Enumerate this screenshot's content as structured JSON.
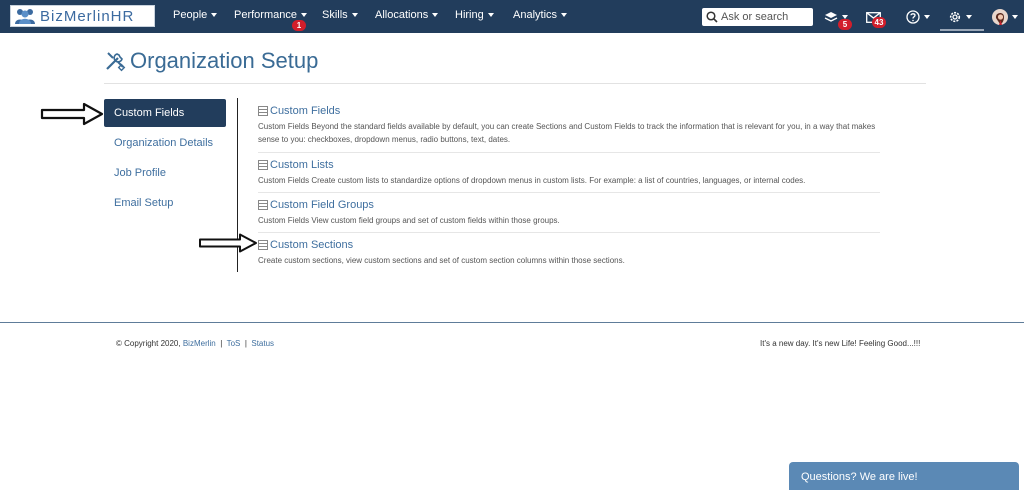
{
  "brand": {
    "name": "BizMerlinHR"
  },
  "nav": [
    {
      "label": "People"
    },
    {
      "label": "Performance",
      "badge": "1"
    },
    {
      "label": "Skills"
    },
    {
      "label": "Allocations"
    },
    {
      "label": "Hiring"
    },
    {
      "label": "Analytics"
    }
  ],
  "search": {
    "placeholder": "Ask or search"
  },
  "header_icons": {
    "layers": {
      "icon": "layers-icon",
      "badge": "5"
    },
    "mail": {
      "icon": "mail-icon",
      "badge": "43"
    },
    "help": {
      "icon": "help-icon"
    },
    "settings": {
      "icon": "gear-icon"
    },
    "avatar": {
      "icon": "avatar-icon"
    }
  },
  "page": {
    "title": "Organization Setup",
    "icon": "tools-icon"
  },
  "sidebar": {
    "items": [
      {
        "label": "Custom Fields",
        "active": true
      },
      {
        "label": "Organization Details"
      },
      {
        "label": "Job Profile"
      },
      {
        "label": "Email Setup"
      }
    ]
  },
  "entries": [
    {
      "title": "Custom Fields",
      "description": "Custom Fields Beyond the standard fields available by default, you can create Sections and Custom Fields to track the information that is relevant for you, in a way that makes sense to you: checkboxes, dropdown menus, radio buttons, text, dates."
    },
    {
      "title": "Custom Lists",
      "description": "Custom Fields Create custom lists to standardize options of dropdown menus in custom lists. For example: a list of countries, languages, or internal codes."
    },
    {
      "title": "Custom Field Groups",
      "description": "Custom Fields View custom field groups and set of custom fields within those groups."
    },
    {
      "title": "Custom Sections",
      "description": "Create custom sections, view custom sections and set of custom section columns within those sections."
    }
  ],
  "footer": {
    "copyright": "© Copyright 2020,",
    "company_link": "BizMerlin",
    "sep": "|",
    "tos": "ToS",
    "status": "Status",
    "tagline": "It's a new day. It's new Life! Feeling Good...!!!"
  },
  "chat": {
    "label": "Questions? We are live!"
  },
  "colors": {
    "topbar": "#223d5c",
    "accent": "#3f6f9f",
    "badge": "#d21e2b",
    "chat": "#5b89b5"
  }
}
